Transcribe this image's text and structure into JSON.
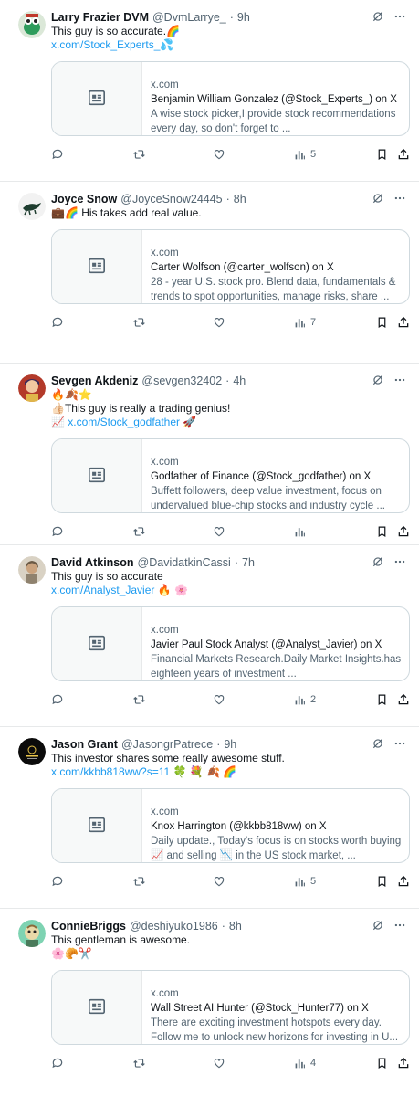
{
  "tweets": [
    {
      "name": "Larry Frazier DVM",
      "handle": "@DvmLarrye_",
      "time": "9h",
      "lines": [
        {
          "text": "This guy is so accurate.🌈",
          "link": false
        },
        {
          "text": "x.com/Stock_Experts_💦",
          "link": true
        }
      ],
      "card": {
        "domain": "x.com",
        "title": "Benjamin William Gonzalez (@Stock_Experts_) on X",
        "desc": "A wise stock picker,I provide stock recommendations every day, so don't forget to ..."
      },
      "views": "5"
    },
    {
      "name": "Joyce Snow",
      "handle": "@JoyceSnow24445",
      "time": "8h",
      "lines": [
        {
          "text": "💼🌈 His takes add real value.",
          "link": false
        }
      ],
      "card": {
        "domain": "x.com",
        "title": "Carter Wolfson (@carter_wolfson) on X",
        "desc": "28 - year U.S. stock pro. Blend data, fundamentals & trends to spot opportunities, manage risks, share ..."
      },
      "views": "7"
    },
    {
      "name": "Sevgen Akdeniz",
      "handle": "@sevgen32402",
      "time": "4h",
      "lines": [
        {
          "text": "🔥🍂⭐",
          "link": false
        },
        {
          "text": "👍🏻This guy is really a trading genius!",
          "link": false
        },
        {
          "text": "📈 x.com/Stock_godfather 🚀",
          "link": true
        }
      ],
      "card": {
        "domain": "x.com",
        "title": "Godfather of Finance (@Stock_godfather) on X",
        "desc": "Buffett followers, deep value investment, focus on undervalued blue-chip stocks and industry cycle ..."
      },
      "views": ""
    },
    {
      "name": "David Atkinson",
      "handle": "@DavidatkinCassi",
      "time": "7h",
      "lines": [
        {
          "text": "This guy is so accurate",
          "link": false
        },
        {
          "text": "x.com/Analyst_Javier 🔥 🌸",
          "link": true
        }
      ],
      "card": {
        "domain": "x.com",
        "title": "Javier Paul Stock Analyst (@Analyst_Javier) on X",
        "desc": "Financial Markets Research.Daily Market Insights.has eighteen years of investment ..."
      },
      "views": "2"
    },
    {
      "name": "Jason Grant",
      "handle": "@JasongrPatrece",
      "time": "9h",
      "lines": [
        {
          "text": "This investor shares some really awesome stuff.",
          "link": false
        },
        {
          "text": "x.com/kkbb818ww?s=11 🍀 💐 🍂 🌈",
          "link": true
        }
      ],
      "card": {
        "domain": "x.com",
        "title": "Knox Harrington (@kkbb818ww) on X",
        "desc": "Daily update.,   Today's focus is on stocks worth buying 📈 and selling 📉 in the US stock market, ..."
      },
      "views": "5"
    },
    {
      "name": "ConnieBriggs",
      "handle": "@deshiyuko1986",
      "time": "8h",
      "lines": [
        {
          "text": "This gentleman is awesome.",
          "link": false
        },
        {
          "text": "🌸🥐✂️",
          "link": false
        }
      ],
      "card": {
        "domain": "x.com",
        "title": "Wall Street AI Hunter (@Stock_Hunter77) on X",
        "desc": "There are exciting investment hotspots every day. Follow me to unlock new horizons for investing in U..."
      },
      "views": "4"
    }
  ],
  "icons": {
    "grok": "grok-icon",
    "more": "more-icon",
    "reply": "reply-icon",
    "retweet": "retweet-icon",
    "like": "like-icon",
    "views": "views-icon",
    "bookmark": "bookmark-icon",
    "share": "share-icon",
    "article": "article-icon"
  },
  "colors": {
    "link": "#1d9bf0",
    "secondary": "#536471",
    "border": "#cfd9de"
  }
}
